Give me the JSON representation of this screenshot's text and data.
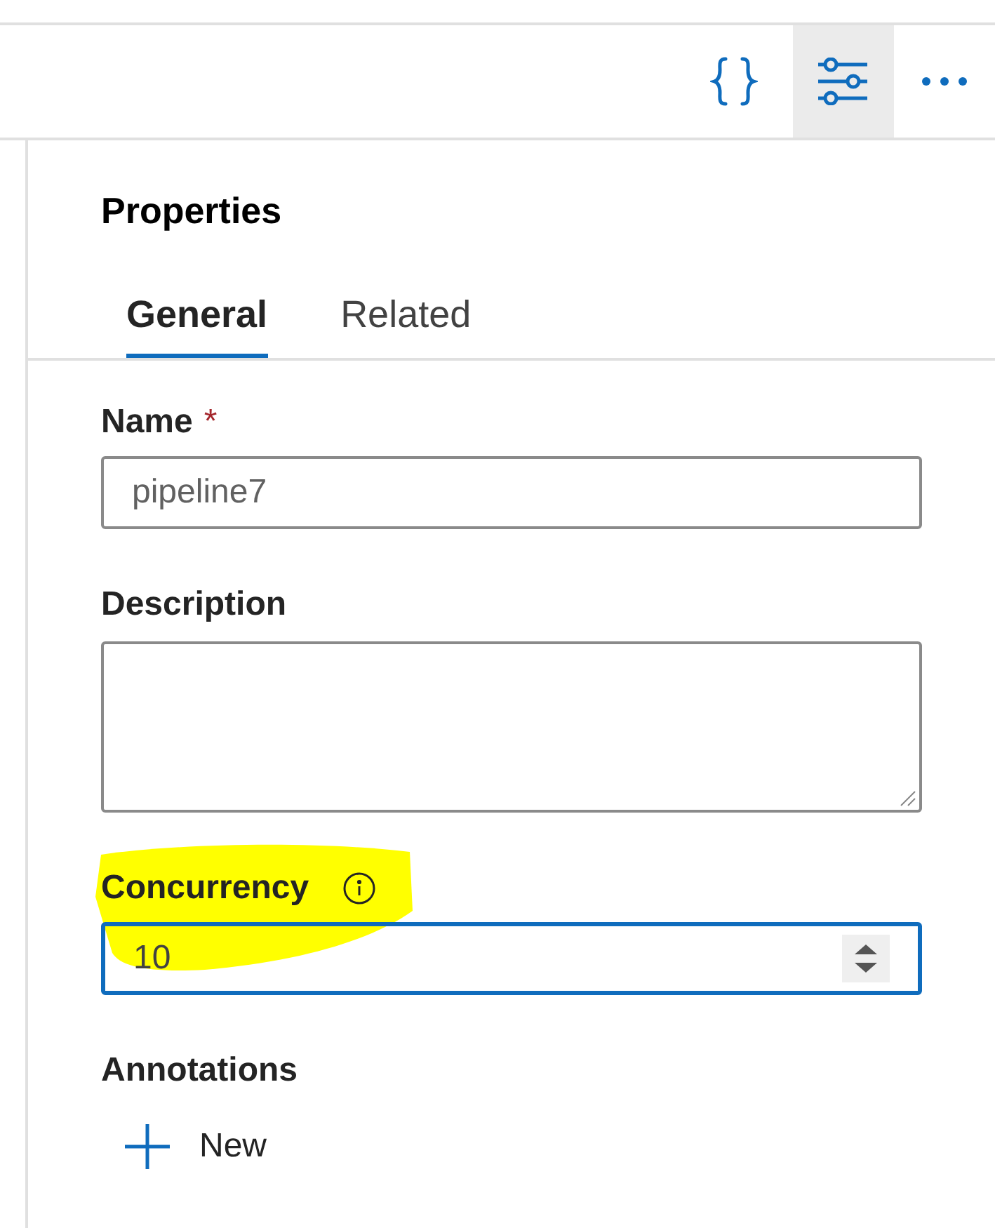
{
  "toolbar": {
    "buttons": [
      {
        "kind": "code",
        "selected": false
      },
      {
        "kind": "properties",
        "selected": true
      },
      {
        "kind": "more",
        "selected": false
      }
    ]
  },
  "panel": {
    "title": "Properties",
    "tabs": [
      {
        "label": "General",
        "selected": true
      },
      {
        "label": "Related",
        "selected": false
      }
    ],
    "fields": [
      {
        "kind": "text",
        "label": "Name",
        "required_mark": "*",
        "value": "pipeline7",
        "focused": false,
        "highlighted": false
      },
      {
        "kind": "textarea",
        "label": "Description",
        "focused": false,
        "highlighted": false
      },
      {
        "kind": "number",
        "label": "Concurrency",
        "info": true,
        "value": "10",
        "focused": true,
        "highlighted": true
      }
    ],
    "annotations": {
      "label": "Annotations",
      "new_button": "New"
    }
  }
}
